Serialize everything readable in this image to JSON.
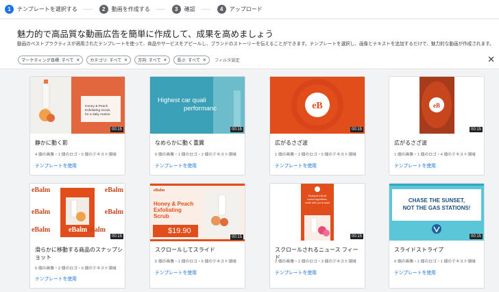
{
  "steps": [
    {
      "num": "1",
      "label": "テンプレートを選択する"
    },
    {
      "num": "2",
      "label": "動画を作成する"
    },
    {
      "num": "3",
      "label": "確認"
    },
    {
      "num": "4",
      "label": "アップロード"
    }
  ],
  "header": {
    "title": "魅力的で高品質な動画広告を簡単に作成して、成果を高めましょう",
    "description": "動画のベストプラクティスが適用されたテンプレートを使って、商品やサービスをアピールし、ブランドのストーリーを伝えることができます。テンプレートを選択し、画像とテキストを追加するだけで、魅力的な動画が作成されます。"
  },
  "filters": {
    "chips": [
      "マーケティング目標: すべて",
      "カテゴリ: すべて",
      "方向: すべて",
      "長さ: すべて"
    ],
    "add_label": "フィルタ設定"
  },
  "link_label": "テンプレートを使用",
  "cards": [
    {
      "title": "静かに動く影",
      "meta": "4 個の画像・1 個のロゴ・6 個のテキスト領域",
      "duration": "00:15",
      "thumb_text": [
        "Honey & Peach",
        "Exfoliating Scrub,",
        "for a daily routine"
      ]
    },
    {
      "title": "なめらかに動く重翼",
      "meta": "0 個の画像・1 個のロゴ・2 個のテキスト領域",
      "duration": "00:15",
      "thumb_text": [
        "Highest car quali",
        "performanc"
      ]
    },
    {
      "title": "広がるさざ波",
      "meta": "1 個の画像・1 個のロゴ・5 個のテキスト領域",
      "duration": "00:15",
      "thumb_text": []
    },
    {
      "title": "広がるさざ波",
      "meta": "1 個の画像・1 個のロゴ・4 個のテキスト領域",
      "duration": "00:15",
      "thumb_text": []
    },
    {
      "title": "滑らかに移動する商品のスナップショット",
      "meta": "6 個の画像・2 個のロゴ・6 個のテキスト領域",
      "duration": "00:15",
      "thumb_text": [
        "eBalm"
      ]
    },
    {
      "title": "スクロールしてスライド",
      "meta": "5 個の画像・1 個のロゴ・5 個のテキスト領域",
      "duration": "00:15",
      "thumb_text": [
        "eBalm",
        "Honey & Peach",
        "Exfoliating",
        "Scrub",
        "$19.90"
      ]
    },
    {
      "title": "スクロールされるニュース フィード",
      "meta": "2 個の画像・1 個のロゴ・3 個のテキスト領域",
      "duration": "00:15",
      "thumb_text": [
        "Produced with all",
        "natural ingredients,",
        "made with you in mind"
      ]
    },
    {
      "title": "スライドストライプ",
      "meta": "0 個の画像・1 個のロゴ・1 個のテキスト領域",
      "duration": "00:15",
      "thumb_text": [
        "CHASE THE SUNSET,",
        "NOT THE GAS STATIONS!"
      ]
    }
  ]
}
